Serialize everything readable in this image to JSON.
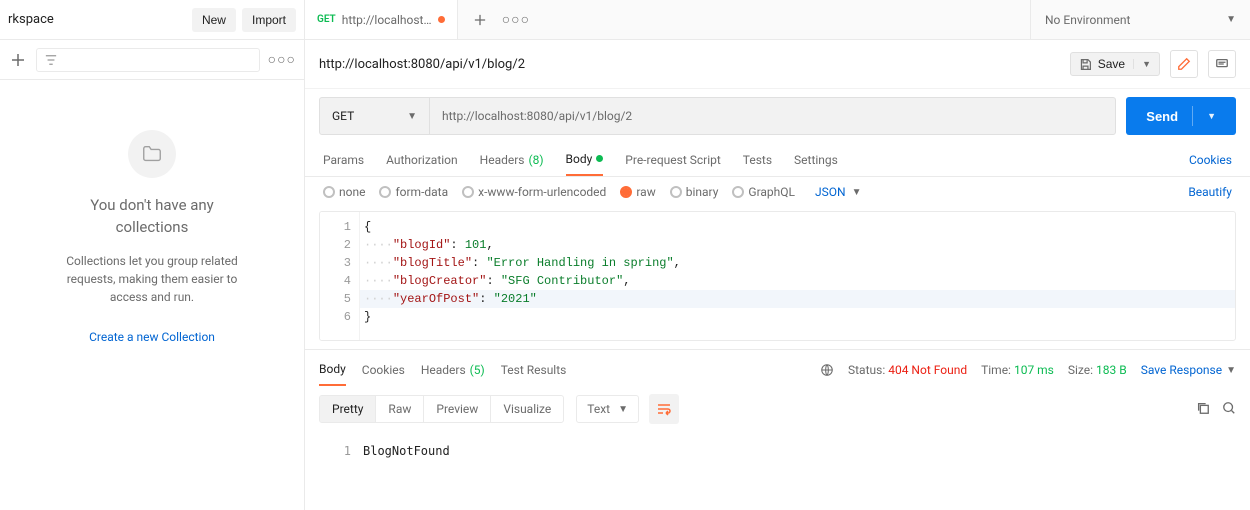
{
  "sidebar": {
    "workspace_label": "rkspace",
    "new_btn": "New",
    "import_btn": "Import",
    "empty_title_line1": "You don't have any",
    "empty_title_line2": "collections",
    "empty_desc": "Collections let you group related requests, making them easier to access and run.",
    "create_link": "Create a new Collection"
  },
  "tabbar": {
    "method": "GET",
    "title": "http://localhost:80...",
    "env": "No Environment"
  },
  "request": {
    "title": "http://localhost:8080/api/v1/blog/2",
    "save_btn": "Save",
    "method": "GET",
    "url": "http://localhost:8080/api/v1/blog/2",
    "send_btn": "Send",
    "subtabs": {
      "params": "Params",
      "authorization": "Authorization",
      "headers": "Headers",
      "headers_count": "(8)",
      "body": "Body",
      "prereq": "Pre-request Script",
      "tests": "Tests",
      "settings": "Settings",
      "cookies": "Cookies"
    },
    "body_opts": {
      "none": "none",
      "formdata": "form-data",
      "xwww": "x-www-form-urlencoded",
      "raw": "raw",
      "binary": "binary",
      "graphql": "GraphQL",
      "format": "JSON",
      "beautify": "Beautify"
    },
    "body_json": {
      "blogId": 101,
      "blogTitle": "Error Handling in spring",
      "blogCreator": "SFG Contributor",
      "yearOfPost": "2021"
    }
  },
  "response": {
    "tabs": {
      "body": "Body",
      "cookies": "Cookies",
      "headers": "Headers",
      "headers_count": "(5)",
      "test_results": "Test Results"
    },
    "status_label": "Status:",
    "status_value": "404 Not Found",
    "time_label": "Time:",
    "time_value": "107 ms",
    "size_label": "Size:",
    "size_value": "183 B",
    "save_response": "Save Response",
    "format": {
      "pretty": "Pretty",
      "raw": "Raw",
      "preview": "Preview",
      "visualize": "Visualize",
      "type": "Text"
    },
    "body_text": "BlogNotFound"
  }
}
